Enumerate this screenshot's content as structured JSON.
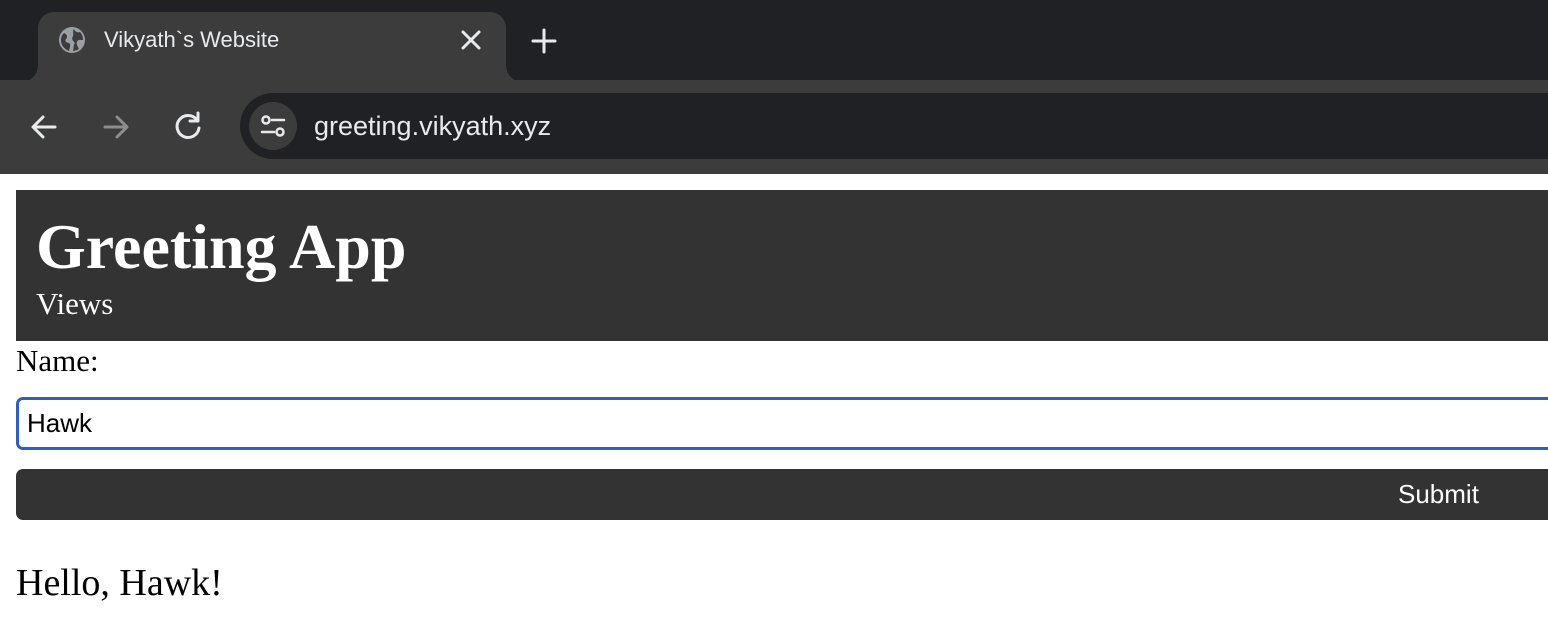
{
  "browser": {
    "tab": {
      "title": "Vikyath`s Website",
      "favicon_icon": "globe-icon",
      "close_icon": "close-icon"
    },
    "new_tab_icon": "plus-icon",
    "nav": {
      "back_icon": "arrow-left-icon",
      "forward_icon": "arrow-right-icon",
      "reload_icon": "reload-icon"
    },
    "omnibox": {
      "site_info_icon": "tune-icon",
      "url": "greeting.vikyath.xyz"
    },
    "colors": {
      "tabstrip_bg": "#202124",
      "toolbar_bg": "#3c3c3c",
      "text": "#e8eaed"
    }
  },
  "page": {
    "header": {
      "title": "Greeting App",
      "subtitle": "Views"
    },
    "form": {
      "name_label": "Name:",
      "name_value": "Hawk",
      "submit_label": "Submit"
    },
    "greeting": "Hello, Hawk!",
    "colors": {
      "header_bg": "#333333",
      "button_bg": "#333333",
      "input_focus_border": "#2c5fc4"
    }
  }
}
